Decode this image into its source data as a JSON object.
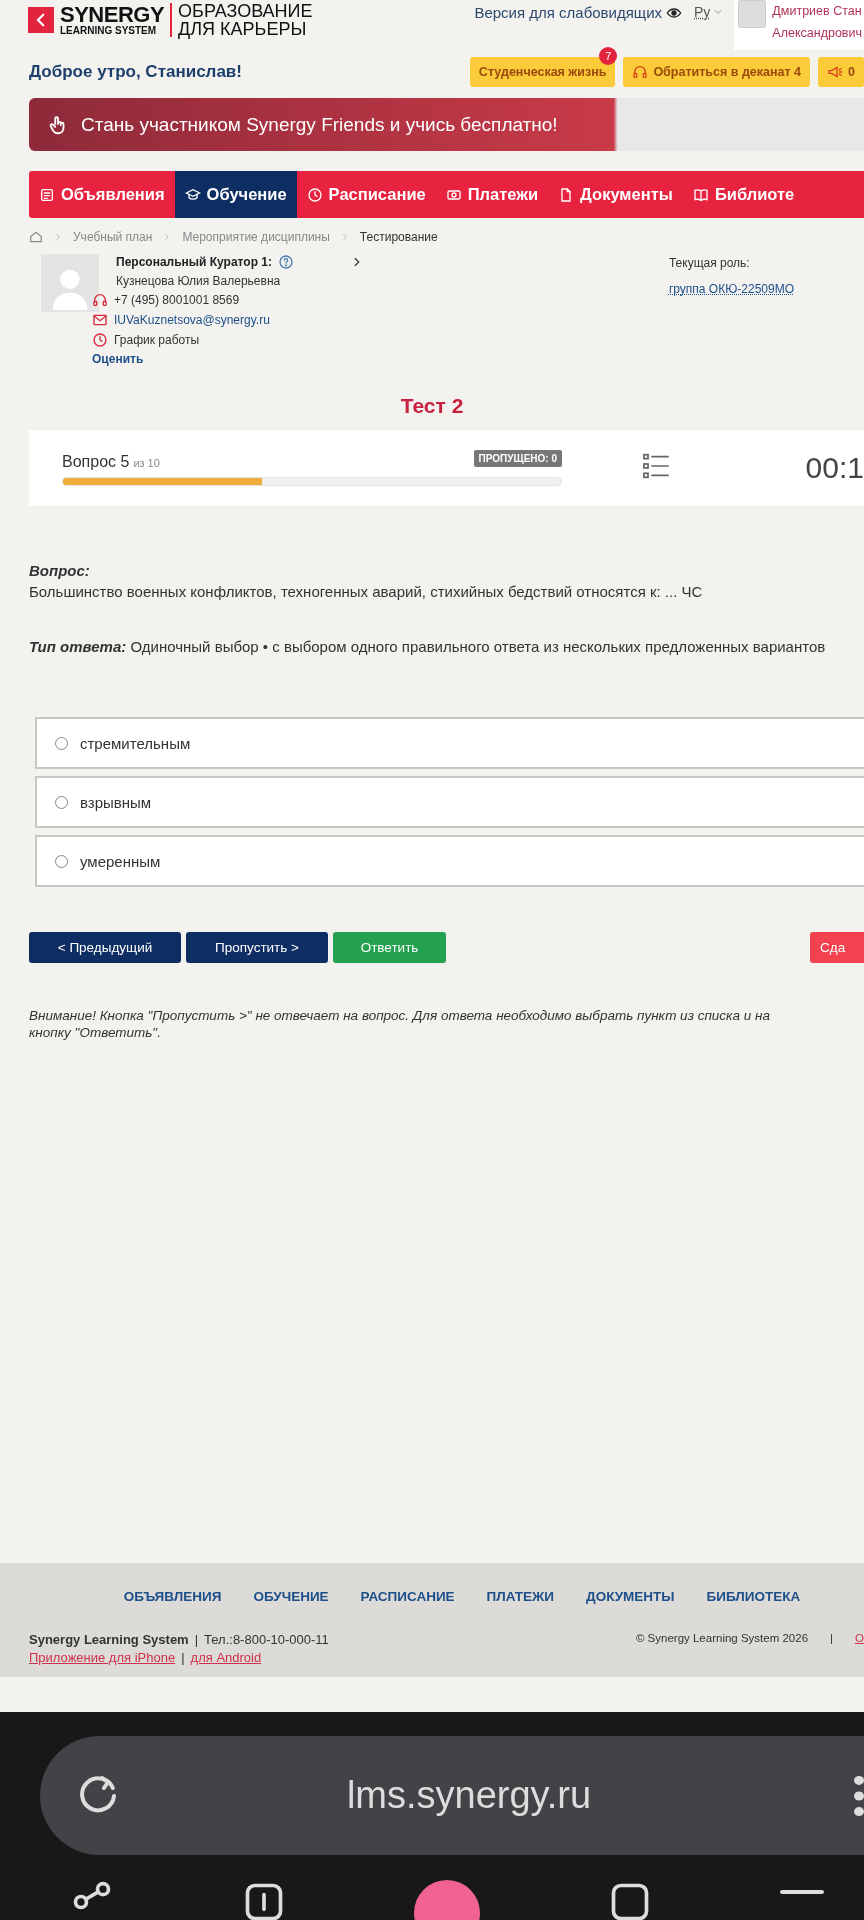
{
  "header": {
    "logo_brand": "SYNERGY",
    "logo_sub": "LEARNING SYSTEM",
    "tagline_1": "ОБРАЗОВАНИЕ",
    "tagline_2": "ДЛЯ КАРЬЕРЫ",
    "accessibility_link": "Версия для слабовидящих",
    "language": "Ру",
    "user_name_1": "Дмитриев Стан",
    "user_name_2": "Александрович"
  },
  "greeting": "Доброе утро, Станислав!",
  "quick_buttons": [
    {
      "kind": "plain",
      "label": "Студенческая жизнь",
      "badge": "7"
    },
    {
      "kind": "headset",
      "label": "Обратиться в деканат 4"
    },
    {
      "kind": "megaphone",
      "label": "0"
    }
  ],
  "banner": {
    "text": "Стань участником Synergy Friends и учись бесплатно!"
  },
  "nav": [
    {
      "kind": "list",
      "label": "Объявления",
      "selected": false
    },
    {
      "kind": "cap",
      "label": "Обучение",
      "selected": true
    },
    {
      "kind": "clock",
      "label": "Расписание",
      "selected": false
    },
    {
      "kind": "money",
      "label": "Платежи",
      "selected": false
    },
    {
      "kind": "doc",
      "label": "Документы",
      "selected": false
    },
    {
      "kind": "book",
      "label": "Библиоте",
      "selected": false
    }
  ],
  "breadcrumbs": [
    "Учебный план",
    "Мероприятие дисциплины",
    "Тестирование"
  ],
  "curator": {
    "title": "Персональный Куратор 1:",
    "name": "Кузнецова Юлия Валерьевна",
    "phone": "+7 (495) 8001001 8569",
    "email": "IUVaKuznetsova@synergy.ru",
    "schedule": "График работы",
    "rate_link": "Оценить"
  },
  "role": {
    "label": "Текущая роль:",
    "value": "группа ОКЮ-22509МО"
  },
  "test": {
    "title": "Тест 2",
    "question_label": "Вопрос 5",
    "question_total": "из 10",
    "skipped_badge": "ПРОПУЩЕНО: 0",
    "level": 0.4,
    "timer": "00:1"
  },
  "question": {
    "label": "Вопрос:",
    "text": "Большинство военных конфликтов, техногенных аварий, стихийных бедствий относятся к: ... ЧС",
    "answer_type_label": "Тип ответа:",
    "answer_type": "Одиночный выбор • с выбором одного правильного ответа из нескольких предложенных вариантов"
  },
  "options": [
    {
      "text": "стремительным",
      "selected": false
    },
    {
      "text": "взрывным",
      "selected": false
    },
    {
      "text": "умеренным",
      "selected": false
    }
  ],
  "buttons": [
    {
      "kind": "secondary",
      "label": "< Предыдущий"
    },
    {
      "kind": "secondary",
      "label": "Пропустить >"
    },
    {
      "kind": "primary",
      "label": "Ответить"
    },
    {
      "kind": "danger",
      "label": "Сда"
    }
  ],
  "notice_lines": [
    "Внимание! Кнопка \"Пропустить >\" не отвечает на вопрос. Для ответа необходимо выбрать пункт из списка и на",
    "кнопку \"Ответить\"."
  ],
  "footer": {
    "separators": [
      "|",
      "|",
      "|"
    ],
    "links": [
      "ОБЪЯВЛЕНИЯ",
      "ОБУЧЕНИЕ",
      "РАСПИСАНИЕ",
      "ПЛАТЕЖИ",
      "ДОКУМЕНТЫ",
      "БИБЛИОТЕКА"
    ],
    "company": "Synergy Learning System",
    "phone": "Тел.:8-800-10-000-11",
    "iphone_link": "Приложение для iPhone",
    "android_link": "для Android",
    "copyright": "© Synergy Learning System 2026",
    "right_link": "О"
  },
  "browser": {
    "url": "lms.synergy.ru"
  }
}
